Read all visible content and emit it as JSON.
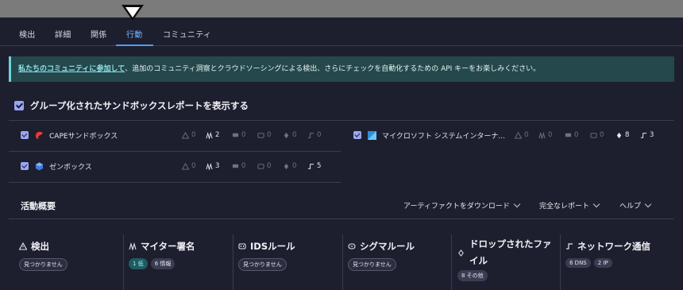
{
  "tabs": [
    {
      "label": "検出"
    },
    {
      "label": "詳細"
    },
    {
      "label": "関係"
    },
    {
      "label": "行動",
      "active": true
    },
    {
      "label": "コミュニティ"
    }
  ],
  "banner": {
    "link_text": "私たちのコミュニティに参加して",
    "text": "、追加のコミュニティ洞察とクラウドソーシングによる検出、さらにチェックを自動化するための API キーをお楽しみください。",
    "accent_color": "#6fd3d8"
  },
  "group_toggle": {
    "label": "グループ化されたサンドボックスレポートを表示する",
    "checked": true
  },
  "sandboxes": [
    {
      "name": "CAPEサンドボックス",
      "logo": "cape-logo",
      "stats": [
        "0",
        "2",
        "0",
        "0",
        "0",
        "0"
      ]
    },
    {
      "name": "マイクロソフト システムインターナ...",
      "logo": "sysinternals-logo",
      "stats": [
        "0",
        "0",
        "0",
        "0",
        "8",
        "3"
      ]
    },
    {
      "name": "ゼンボックス",
      "logo": "zenbox-logo",
      "stats": [
        "0",
        "3",
        "0",
        "0",
        "0",
        "5"
      ]
    }
  ],
  "activity": {
    "title": "活動概要",
    "menus": [
      "アーティファクトをダウンロード",
      "完全なレポート",
      "ヘルプ"
    ]
  },
  "cards": [
    {
      "title": "検出",
      "icon": "warning-icon",
      "pills": [
        {
          "text": "見つかりません",
          "style": "outline"
        }
      ]
    },
    {
      "title": "マイター署名",
      "icon": "mitre-icon",
      "pills": [
        {
          "text": "1 低",
          "style": "teal"
        },
        {
          "text": "6 情報",
          "style": "solid"
        }
      ]
    },
    {
      "title": "IDSルール",
      "icon": "ids-icon",
      "pills": [
        {
          "text": "見つかりません",
          "style": "outline"
        }
      ]
    },
    {
      "title": "シグマルール",
      "icon": "sigma-icon",
      "pills": [
        {
          "text": "見つかりません",
          "style": "outline"
        }
      ]
    },
    {
      "title": "ドロップされたファイル",
      "icon": "drop-icon",
      "pills": [
        {
          "text": "8 その他",
          "style": "solid"
        }
      ]
    },
    {
      "title": "ネットワーク通信",
      "icon": "network-icon",
      "pills": [
        {
          "text": "6 DNS",
          "style": "solid"
        },
        {
          "text": "2 IP",
          "style": "solid"
        }
      ]
    }
  ]
}
